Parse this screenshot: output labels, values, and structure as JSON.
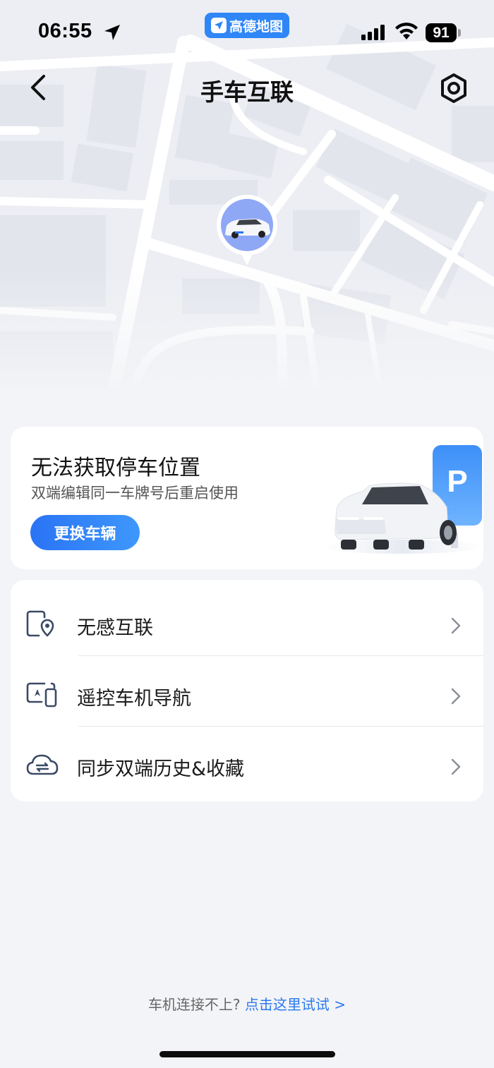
{
  "status_bar": {
    "time": "06:55",
    "app_name": "高德地图",
    "battery": "91"
  },
  "nav": {
    "title": "手车互联"
  },
  "parking_card": {
    "title": "无法获取停车位置",
    "subtitle": "双端编辑同一车牌号后重启使用",
    "button_label": "更换车辆",
    "sign_letter": "P"
  },
  "list": {
    "items": [
      {
        "label": "无感互联",
        "icon": "phone-location-icon"
      },
      {
        "label": "遥控车机导航",
        "icon": "screen-phone-icon"
      },
      {
        "label": "同步双端历史&收藏",
        "icon": "cloud-sync-icon"
      }
    ]
  },
  "footer": {
    "prompt": "车机连接不上?",
    "link": "点击这里试试 >"
  },
  "colors": {
    "accent": "#2a78f0",
    "background": "#f3f4f7",
    "card": "#ffffff"
  }
}
